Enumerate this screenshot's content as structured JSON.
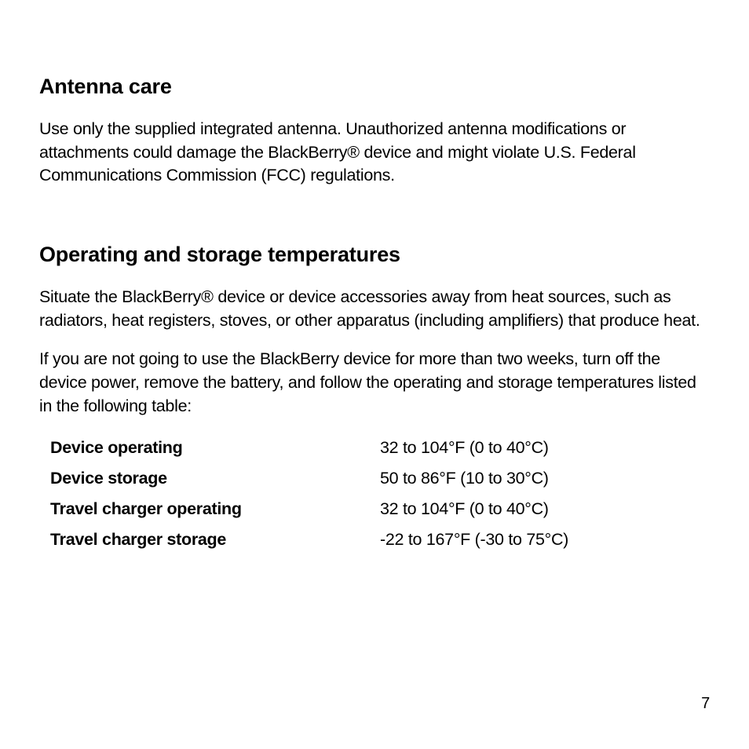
{
  "sections": {
    "antenna": {
      "heading": "Antenna care",
      "paragraph": "Use only the supplied integrated antenna. Unauthorized antenna modifications or attachments could damage the BlackBerry® device and might violate U.S. Federal Communications Commission (FCC) regulations."
    },
    "temperatures": {
      "heading": "Operating and storage temperatures",
      "paragraph1": "Situate the BlackBerry® device or device accessories away from heat sources, such as radiators, heat registers, stoves, or other apparatus (including amplifiers) that produce heat.",
      "paragraph2": "If you are not going to use the BlackBerry device for more than two weeks, turn off the device power, remove the battery, and follow the operating and storage temperatures listed in the following table:",
      "rows": [
        {
          "label": "Device operating",
          "value": "32 to 104°F (0 to 40°C)"
        },
        {
          "label": "Device storage",
          "value": "50 to 86°F (10 to 30°C)"
        },
        {
          "label": "Travel charger operating",
          "value": "32 to 104°F (0 to 40°C)"
        },
        {
          "label": "Travel charger storage",
          "value": "-22 to 167°F (-30 to 75°C)"
        }
      ]
    }
  },
  "pageNumber": "7"
}
